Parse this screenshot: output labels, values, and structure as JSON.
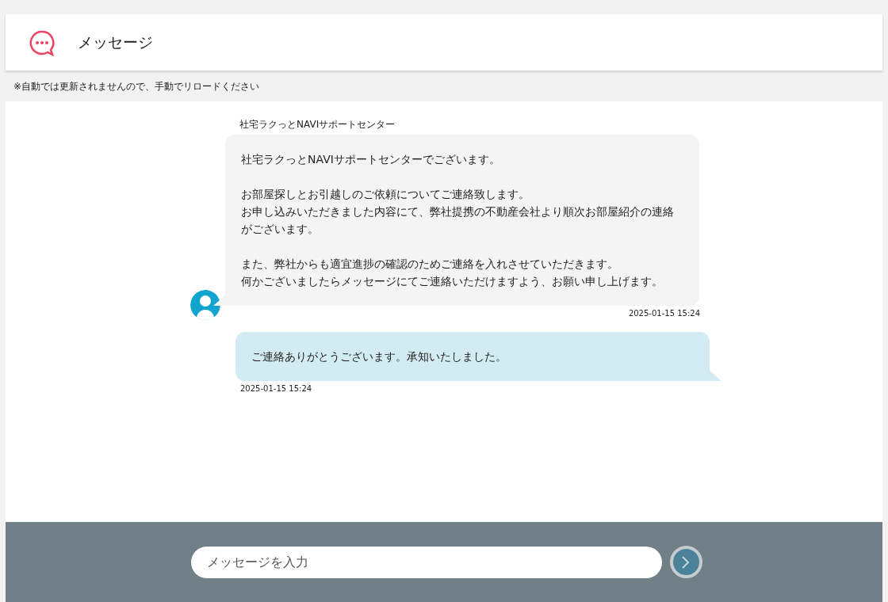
{
  "header": {
    "title": "メッセージ"
  },
  "notice": "※自動では更新されませんので、手動でリロードください",
  "messages": [
    {
      "kind": "received",
      "sender": "社宅ラクっとNAVIサポートセンター",
      "paragraphs": [
        [
          "社宅ラクっとNAVIサポートセンターでございます。"
        ],
        [
          "お部屋探しとお引越しのご依頼についてご連絡致します。",
          "お申し込みいただきました内容にて、弊社提携の不動産会社より順次お部屋紹介の連絡がございます。"
        ],
        [
          "また、弊社からも適宜進捗の確認のためご連絡を入れさせていただきます。",
          "何かございましたらメッセージにてご連絡いただけますよう、お願い申し上げます。"
        ]
      ],
      "time": "2025-01-15 15:24"
    },
    {
      "kind": "sent",
      "paragraphs": [
        [
          "ご連絡ありがとうございます。承知いたしました。"
        ]
      ],
      "time": "2025-01-15 15:24"
    }
  ],
  "composer": {
    "placeholder": "メッセージを入力"
  }
}
